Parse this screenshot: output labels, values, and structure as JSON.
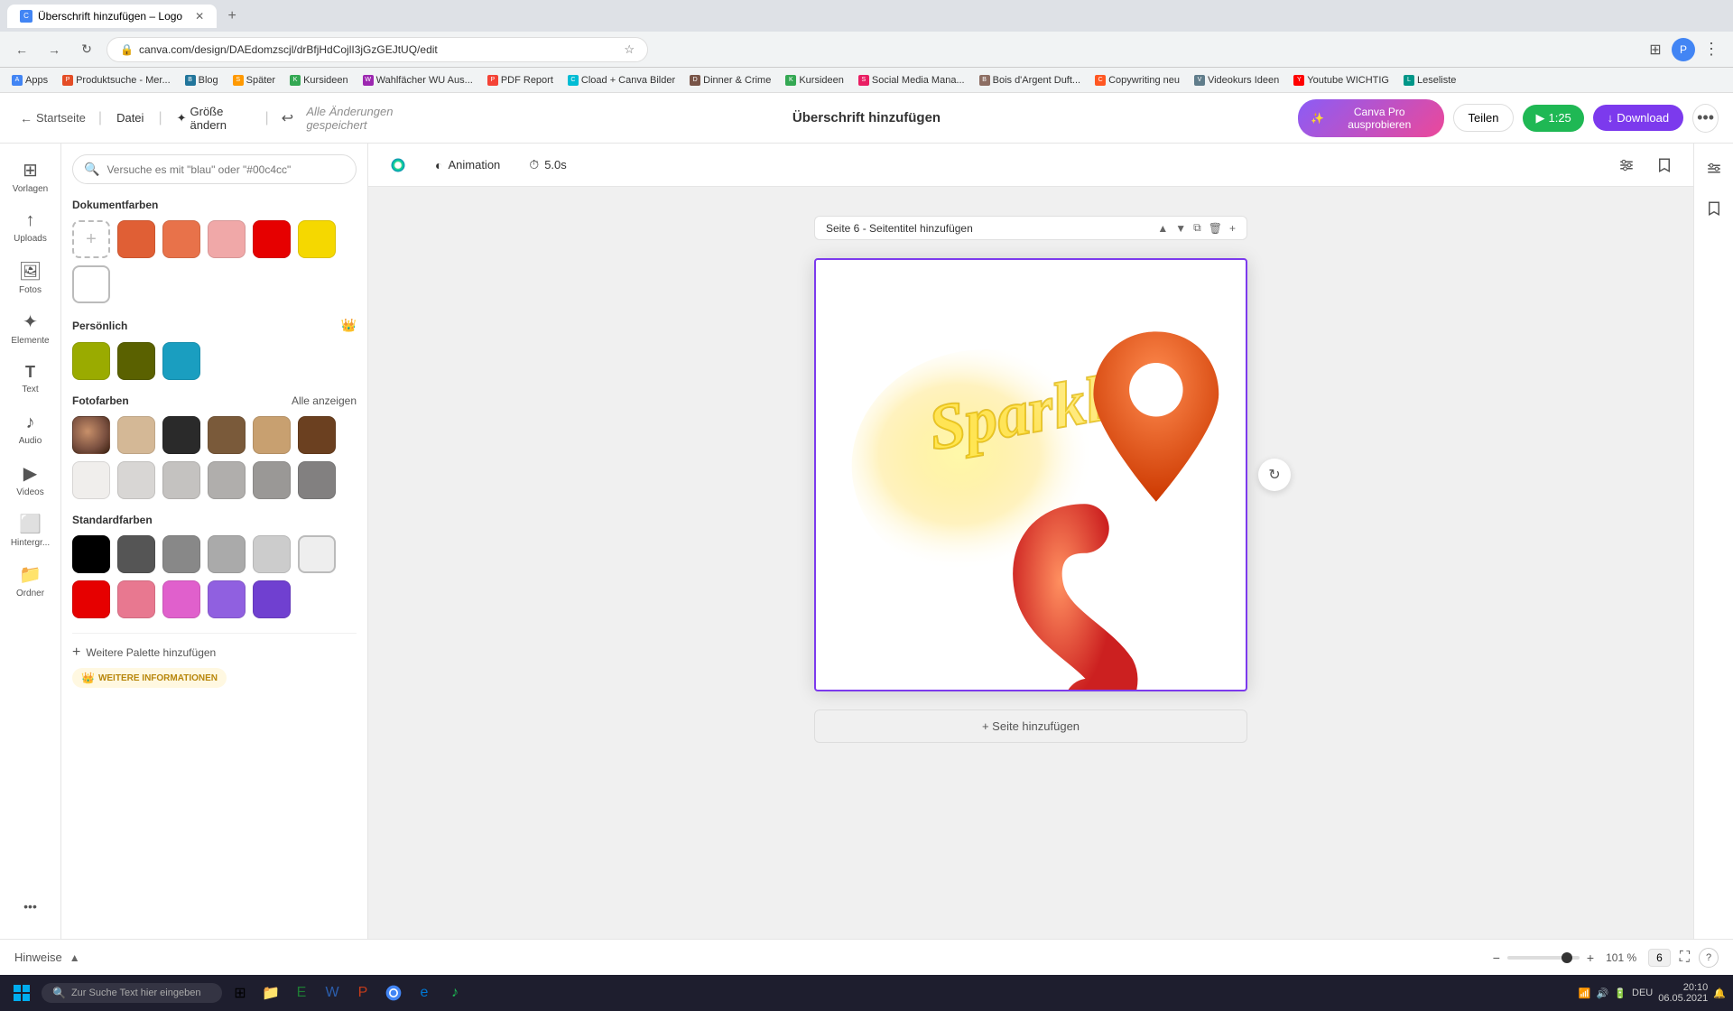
{
  "browser": {
    "tab_title": "Überschrift hinzufügen – Logo",
    "favicon_text": "C",
    "address": "canva.com/design/DAEdomzscjl/drBfjHdCojlI3jGzGEJtUQ/edit",
    "new_tab_label": "+",
    "bookmarks": [
      {
        "label": "Apps",
        "icon": "A"
      },
      {
        "label": "Produktsuche - Mer...",
        "icon": "P"
      },
      {
        "label": "Blog",
        "icon": "B"
      },
      {
        "label": "Später",
        "icon": "S"
      },
      {
        "label": "Kursideen",
        "icon": "K"
      },
      {
        "label": "Wahlfächer WU Aus...",
        "icon": "W"
      },
      {
        "label": "PDF Report",
        "icon": "P"
      },
      {
        "label": "Cload + Canva Bilder",
        "icon": "C"
      },
      {
        "label": "Dinner & Crime",
        "icon": "D"
      },
      {
        "label": "Kursideen",
        "icon": "K"
      },
      {
        "label": "Social Media Mana...",
        "icon": "S"
      },
      {
        "label": "Bois d'Argent Duft...",
        "icon": "B"
      },
      {
        "label": "Copywriting neu",
        "icon": "C"
      },
      {
        "label": "Videokurs Ideen",
        "icon": "V"
      },
      {
        "label": "Youtube WICHTIG",
        "icon": "Y"
      },
      {
        "label": "Leseliste",
        "icon": "L"
      }
    ]
  },
  "topbar": {
    "home_label": "Startseite",
    "file_label": "Datei",
    "resize_label": "Größe ändern",
    "saved_status": "Alle Änderungen gespeichert",
    "doc_title": "Überschrift hinzufügen",
    "canva_pro_label": "Canva Pro ausprobieren",
    "share_label": "Teilen",
    "play_time": "1:25",
    "download_label": "Download",
    "more_icon": "•••"
  },
  "canvas_toolbar": {
    "animation_label": "Animation",
    "duration_label": "5.0s",
    "palette_icon": "🎨"
  },
  "icon_sidebar": {
    "items": [
      {
        "id": "vorlagen",
        "label": "Vorlagen",
        "icon": "⊞"
      },
      {
        "id": "uploads",
        "label": "Uploads",
        "icon": "↑"
      },
      {
        "id": "fotos",
        "label": "Fotos",
        "icon": "🖼"
      },
      {
        "id": "elemente",
        "label": "Elemente",
        "icon": "✦"
      },
      {
        "id": "text",
        "label": "Text",
        "icon": "T"
      },
      {
        "id": "audio",
        "label": "Audio",
        "icon": "♪"
      },
      {
        "id": "videos",
        "label": "Videos",
        "icon": "▶"
      },
      {
        "id": "hintergrund",
        "label": "Hintergr...",
        "icon": "⬜"
      },
      {
        "id": "ordner",
        "label": "Ordner",
        "icon": "📁"
      },
      {
        "id": "more",
        "label": "...",
        "icon": "•••"
      }
    ]
  },
  "color_panel": {
    "search_placeholder": "Versuche es mit \"blau\" oder \"#00c4cc\"",
    "document_colors_title": "Dokumentfarben",
    "document_colors": [
      {
        "id": "add",
        "type": "add",
        "color": "transparent"
      },
      {
        "id": "c1",
        "color": "#e05f35"
      },
      {
        "id": "c2",
        "color": "#e8724a"
      },
      {
        "id": "c3",
        "color": "#f0a8a8"
      },
      {
        "id": "c4",
        "color": "#e60000"
      },
      {
        "id": "c5",
        "color": "#f5d800"
      },
      {
        "id": "c6",
        "color": "#ffffff",
        "bordered": true
      }
    ],
    "personal_title": "Persönlich",
    "personal_colors": [
      {
        "id": "p1",
        "color": "#9aab00"
      },
      {
        "id": "p2",
        "color": "#5a6100"
      },
      {
        "id": "p3",
        "color": "#1a9ec0"
      }
    ],
    "photo_colors_title": "Fotofarben",
    "show_all_label": "Alle anzeigen",
    "photo_colors": [
      {
        "id": "ph1",
        "color": "#b8805a",
        "is_photo": true
      },
      {
        "id": "ph2",
        "color": "#d4b896"
      },
      {
        "id": "ph3",
        "color": "#2a2a2a"
      },
      {
        "id": "ph4",
        "color": "#7a5a3a"
      },
      {
        "id": "ph5",
        "color": "#c8a070"
      },
      {
        "id": "ph6",
        "color": "#6b4020"
      },
      {
        "id": "ph7",
        "color": "#e8e8e8"
      },
      {
        "id": "ph8",
        "color": "#d8d8d8"
      },
      {
        "id": "ph9",
        "color": "#c8c8c8"
      },
      {
        "id": "ph10",
        "color": "#b8b8b8"
      },
      {
        "id": "ph11",
        "color": "#a8a8a8"
      },
      {
        "id": "ph12",
        "color": "#929292"
      }
    ],
    "standard_colors_title": "Standardfarben",
    "standard_colors": [
      {
        "id": "s1",
        "color": "#000000"
      },
      {
        "id": "s2",
        "color": "#555555"
      },
      {
        "id": "s3",
        "color": "#888888"
      },
      {
        "id": "s4",
        "color": "#aaaaaa"
      },
      {
        "id": "s5",
        "color": "#cccccc"
      },
      {
        "id": "s6",
        "color": "#eeeeee"
      },
      {
        "id": "s7",
        "color": "#e60000"
      },
      {
        "id": "s8",
        "color": "#e87890"
      },
      {
        "id": "s9",
        "color": "#e060cc"
      },
      {
        "id": "s10",
        "color": "#9060e0"
      },
      {
        "id": "s11",
        "color": "#7040d0"
      }
    ],
    "add_palette_label": "Weitere Palette hinzufügen",
    "more_info_label": "WEITERE INFORMATIONEN"
  },
  "page_header": {
    "label": "Seite 6 - Seitentitel hinzufügen",
    "up_icon": "▲",
    "down_icon": "▼",
    "copy_icon": "⧉",
    "delete_icon": "🗑",
    "add_icon": "+"
  },
  "canvas": {
    "sparkle_text": "Sparkle"
  },
  "add_page_label": "+ Seite hinzufügen",
  "bottom_bar": {
    "hints_label": "Hinweise",
    "up_icon": "▲",
    "zoom_percent": "101 %",
    "page_count": "6",
    "fullscreen_icon": "⛶",
    "help_icon": "?"
  },
  "taskbar": {
    "search_placeholder": "Zur Suche Text hier eingeben",
    "time": "20:10",
    "date": "06.05.2021",
    "system_icons": [
      "DEU"
    ]
  },
  "right_panel": {
    "adjust_icon": "⚙",
    "bookmark_icon": "🔖"
  }
}
